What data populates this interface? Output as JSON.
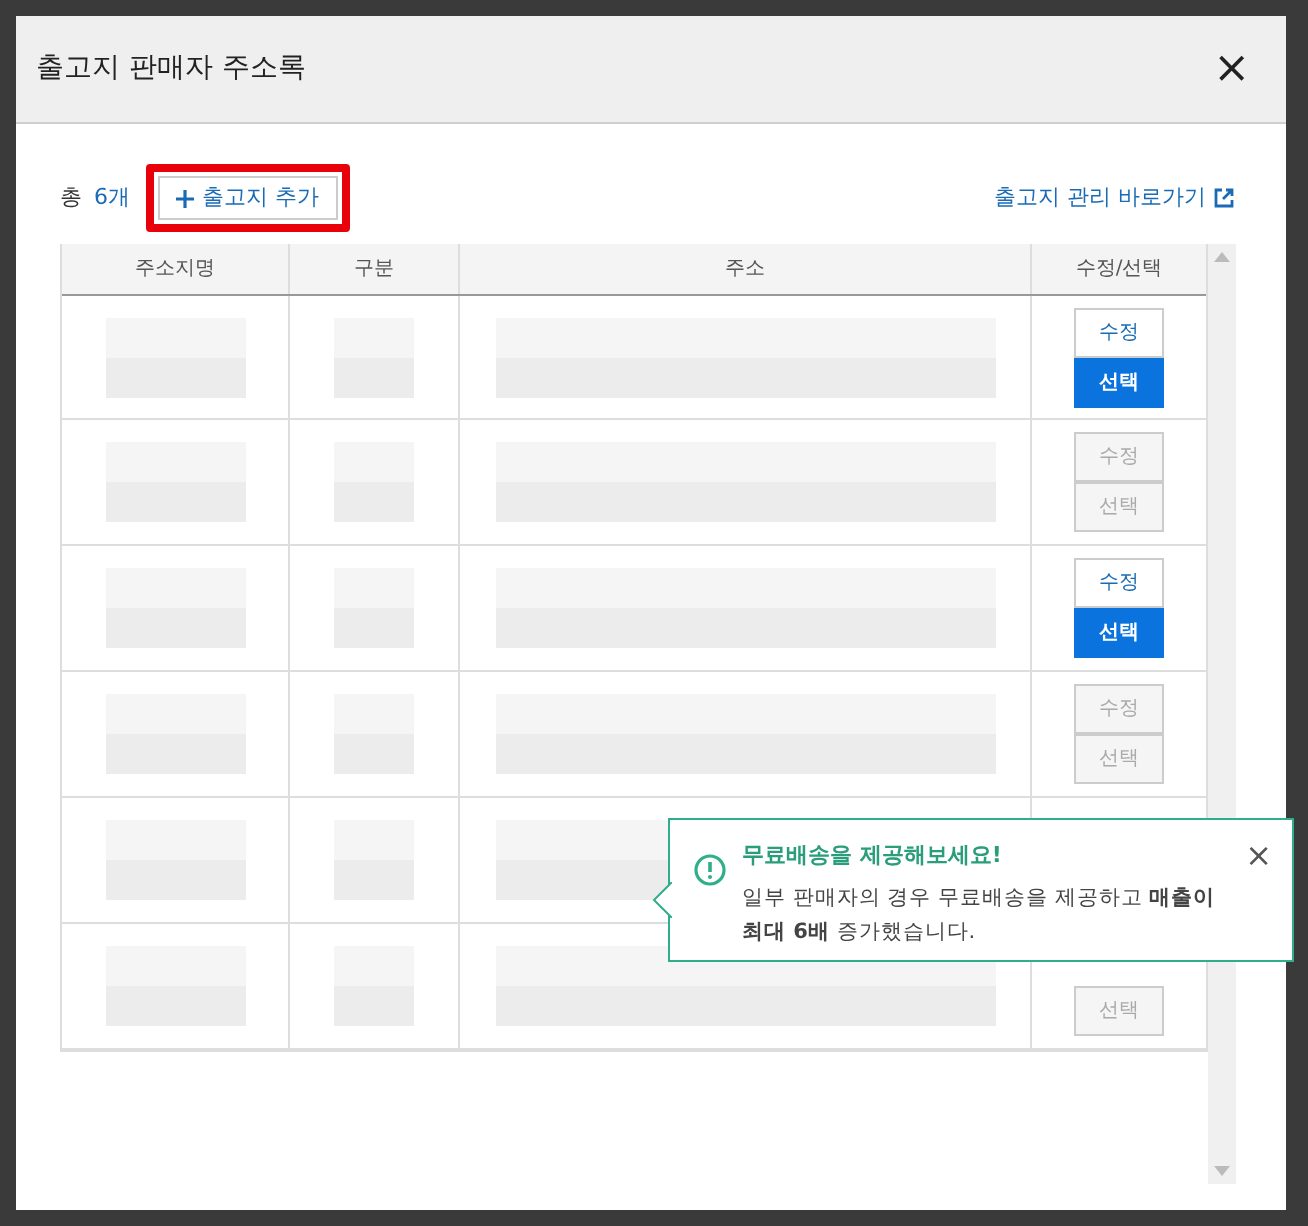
{
  "dialog": {
    "title": "출고지 판매자 주소록",
    "close": "×"
  },
  "toolbar": {
    "total_label": "총",
    "total_count": "6개",
    "add_button": "출고지 추가",
    "manage_link": "출고지 관리 바로가기"
  },
  "table": {
    "columns": [
      "주소지명",
      "구분",
      "주소",
      "수정/선택"
    ],
    "rows": [
      {
        "enabled": true,
        "edit": "수정",
        "select": "선택"
      },
      {
        "enabled": false,
        "edit": "수정",
        "select": "선택"
      },
      {
        "enabled": true,
        "edit": "수정",
        "select": "선택"
      },
      {
        "enabled": false,
        "edit": "수정",
        "select": "선택"
      },
      {},
      {
        "enabled": false,
        "select": "선택"
      }
    ]
  },
  "tooltip": {
    "title": "무료배송을 제공해보세요!",
    "body": "일부 판매자의 경우 무료배송을 제공하고 **매출이 최대 6배** 증가했습니다.",
    "close": "×"
  }
}
